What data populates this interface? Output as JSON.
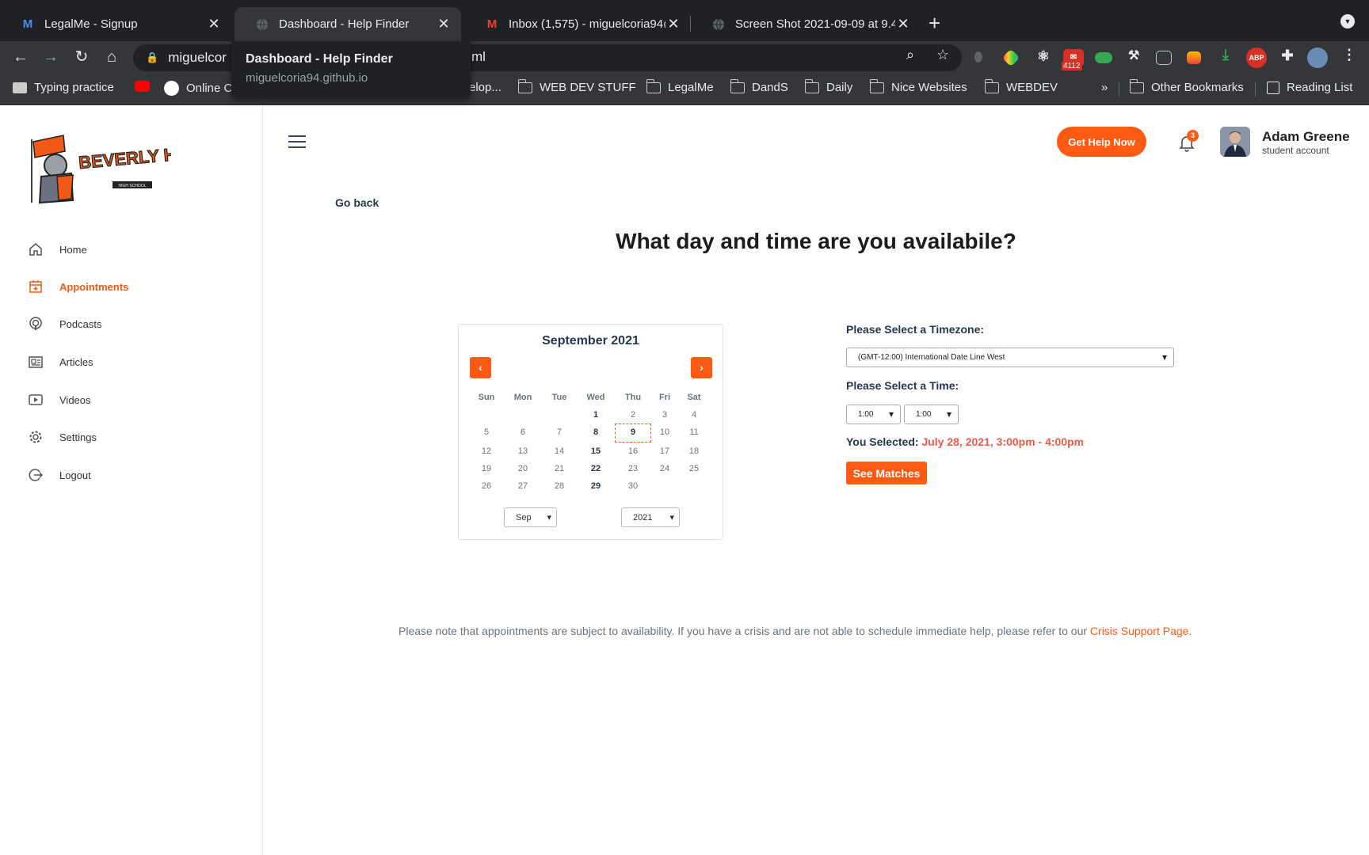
{
  "browser": {
    "tabs": [
      {
        "title": "LegalMe - Signup",
        "favicon": "legalme-icon"
      },
      {
        "title": "Dashboard - Help Finder",
        "favicon": "globe-icon"
      },
      {
        "title": "Inbox (1,575) - miguelcoria94@",
        "favicon": "gmail-icon"
      },
      {
        "title": "Screen Shot 2021-09-09 at 9.4",
        "favicon": "globe-icon"
      }
    ],
    "url_visible": "miguelcor",
    "url_tail": "ml",
    "tooltip": {
      "title": "Dashboard - Help Finder",
      "domain": "miguelcoria94.github.io"
    },
    "extension_badge": "4112",
    "extension_abp": "ABP",
    "bookmarks": [
      "Typing practice",
      "Online C",
      "elop...",
      "WEB DEV STUFF",
      "LegalMe",
      "DandS",
      "Daily",
      "Nice Websites",
      "WEBDEV"
    ],
    "bookmarks_overflow": "»",
    "other_bookmarks": "Other Bookmarks",
    "reading_list": "Reading List"
  },
  "sidebar": {
    "logo_text": "BEVERLY HILLS",
    "logo_sub": "HIGH SCHOOL",
    "items": [
      {
        "label": "Home",
        "icon": "home-icon"
      },
      {
        "label": "Appointments",
        "icon": "calendar-icon"
      },
      {
        "label": "Podcasts",
        "icon": "podcast-icon"
      },
      {
        "label": "Articles",
        "icon": "newspaper-icon"
      },
      {
        "label": "Videos",
        "icon": "video-icon"
      },
      {
        "label": "Settings",
        "icon": "gear-icon"
      },
      {
        "label": "Logout",
        "icon": "logout-icon"
      }
    ],
    "active_index": 1
  },
  "header": {
    "help_button": "Get Help Now",
    "notification_count": "3",
    "user_name": "Adam Greene",
    "user_role": "student account"
  },
  "main": {
    "go_back": "Go back",
    "heading": "What day and time are you availabile?",
    "calendar": {
      "title": "September 2021",
      "prev": "‹",
      "next": "›",
      "weekdays": [
        "Sun",
        "Mon",
        "Tue",
        "Wed",
        "Thu",
        "Fri",
        "Sat"
      ],
      "weeks": [
        [
          "",
          "",
          "",
          "1",
          "2",
          "3",
          "4"
        ],
        [
          "5",
          "6",
          "7",
          "8",
          "9",
          "10",
          "11"
        ],
        [
          "12",
          "13",
          "14",
          "15",
          "16",
          "17",
          "18"
        ],
        [
          "19",
          "20",
          "21",
          "22",
          "23",
          "24",
          "25"
        ],
        [
          "26",
          "27",
          "28",
          "29",
          "30",
          "",
          ""
        ]
      ],
      "selected_day": "9",
      "month_select": "Sep",
      "year_select": "2021"
    },
    "timezone_label": "Please Select a Timezone:",
    "timezone_value": "(GMT-12:00) International Date Line West",
    "time_label": "Please Select a Time:",
    "time_start": "1:00",
    "time_end": "1:00",
    "selected_label": "You Selected:",
    "selected_value": "July 28, 2021, 3:00pm - 4:00pm",
    "see_matches": "See Matches",
    "note": "Please note that appointments are subject to availability. If you have a crisis and are not able to schedule immediate help, please refer to our ",
    "note_link": "Crisis Support Page."
  },
  "colors": {
    "accent": "#ff5a14",
    "selected_text": "#f05a4b",
    "navy": "#2c3550"
  }
}
